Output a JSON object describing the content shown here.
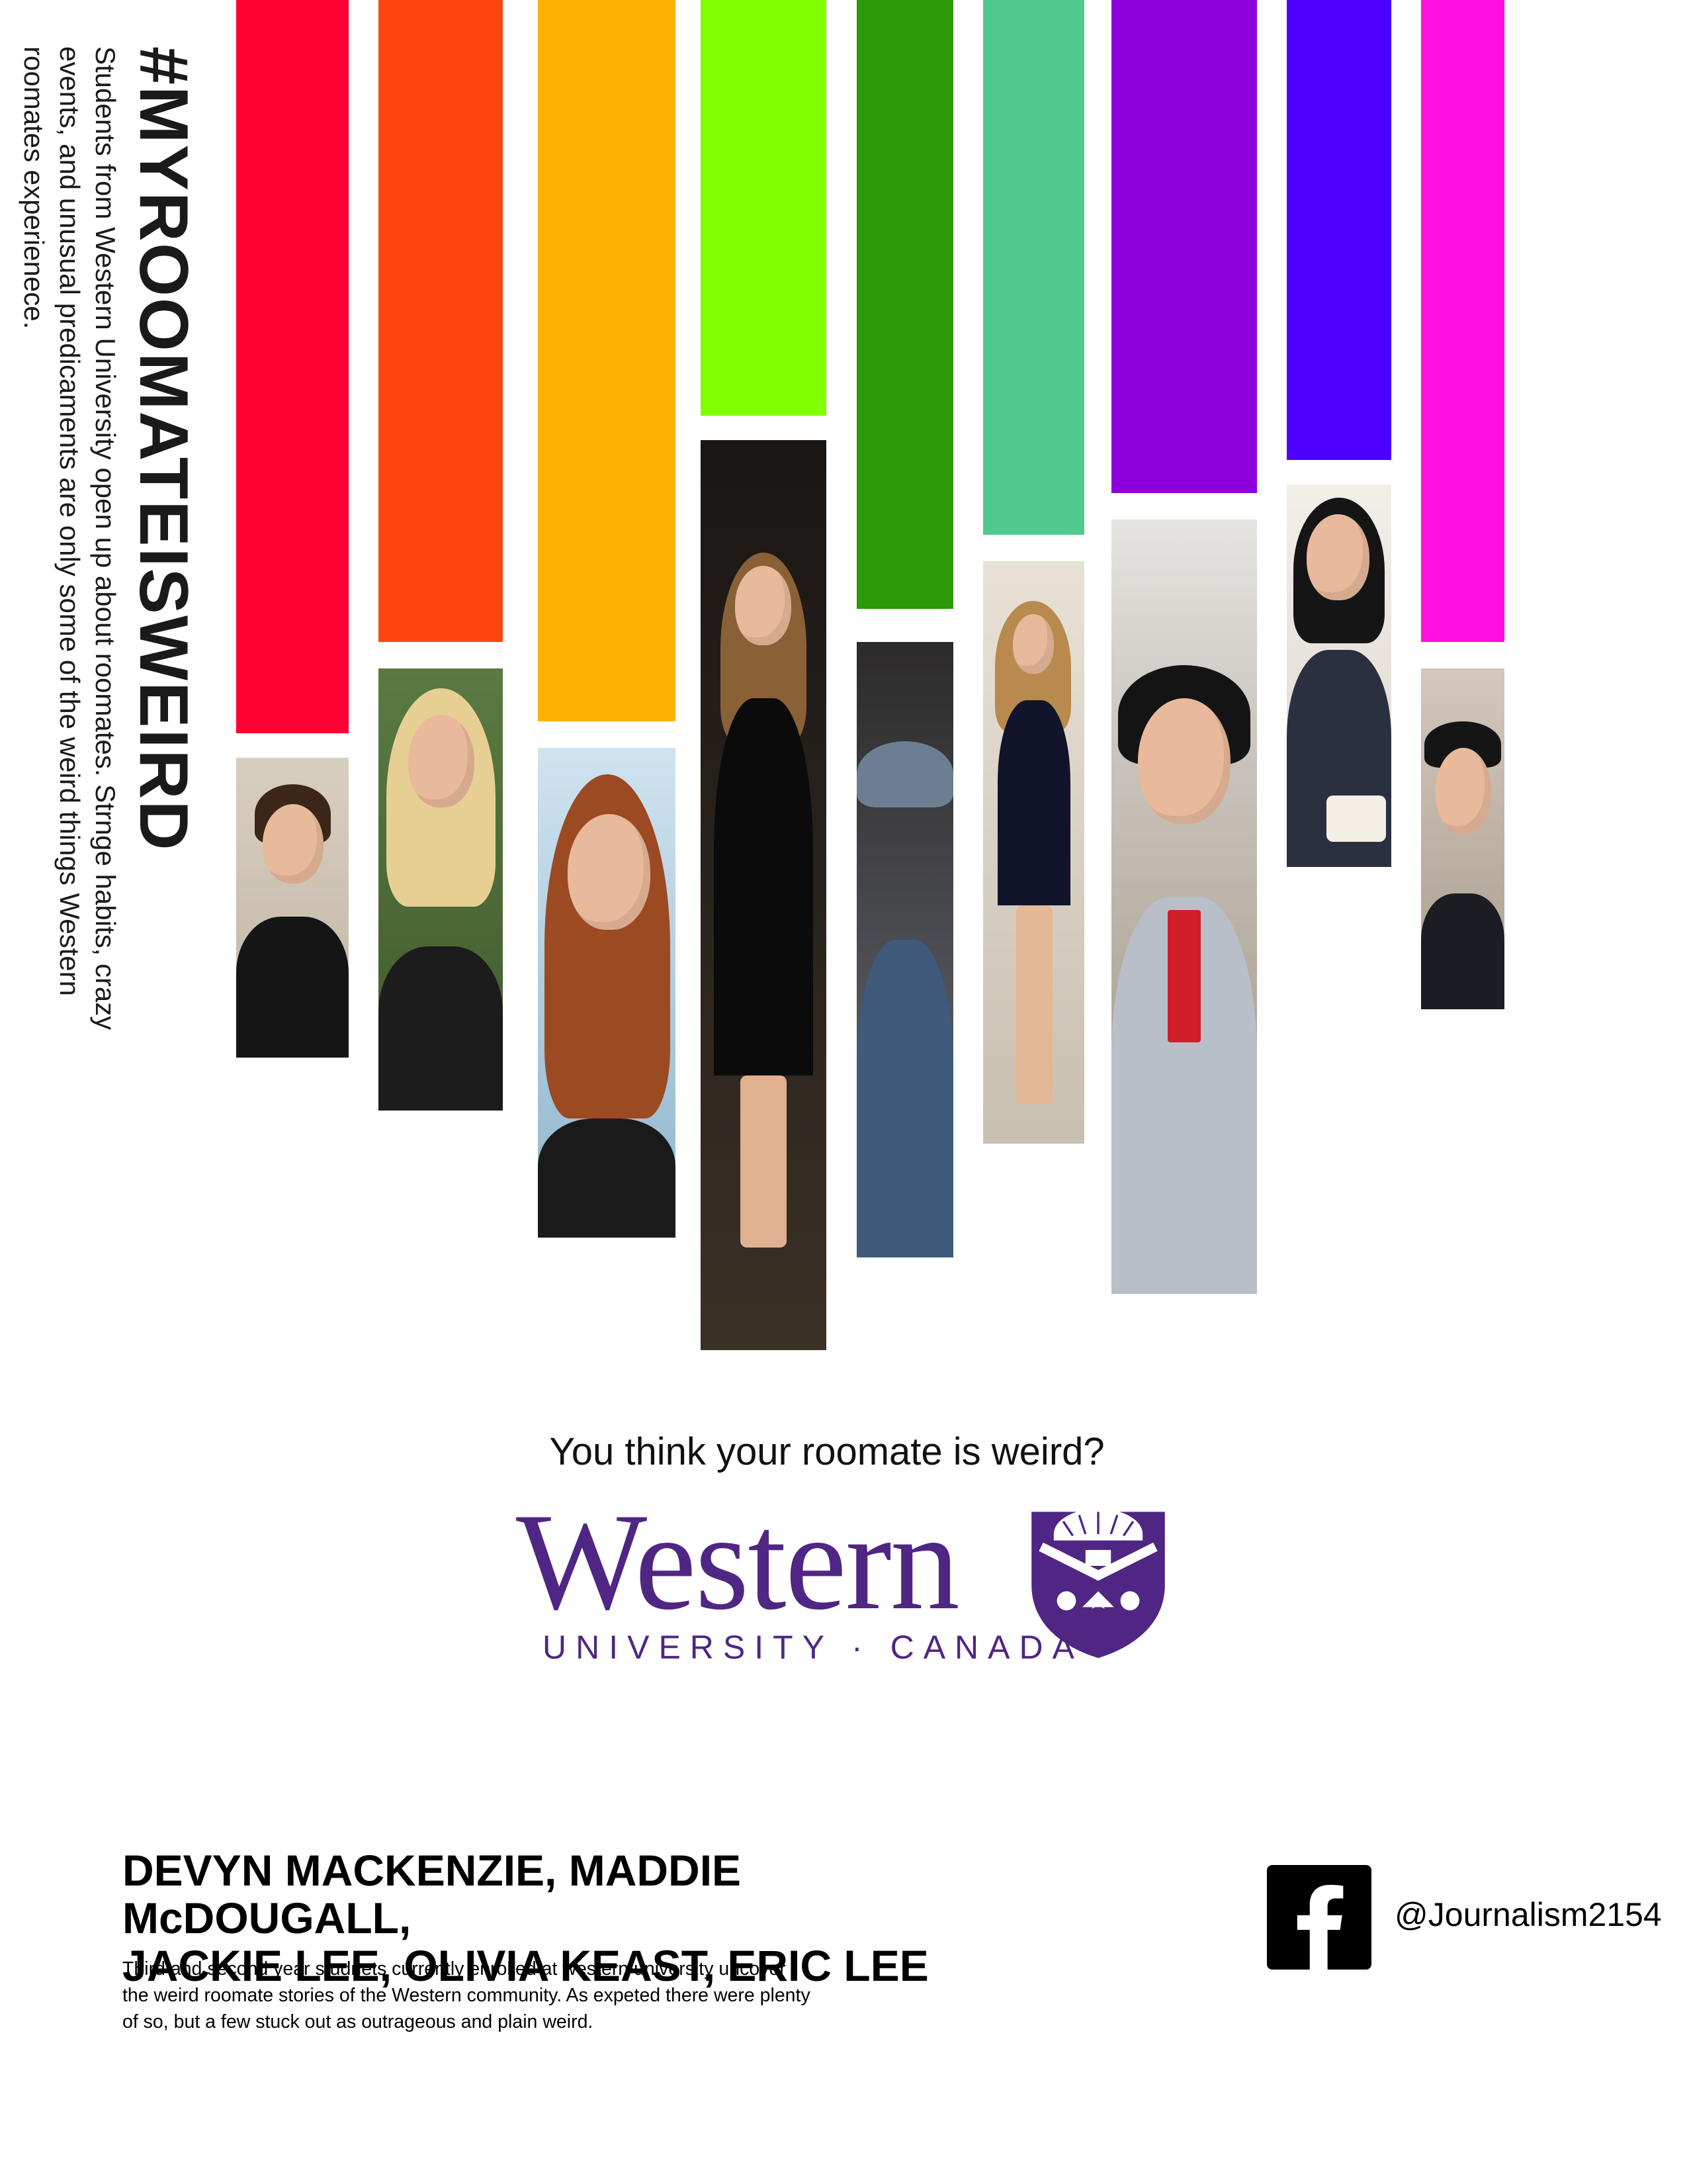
{
  "poster": {
    "hashtag": "#MYROOMATEISWEIRD",
    "tagline": "Students from Western University open up about roomates. Strnge habits, crazy events, and unusual predicaments are only some of the weird things Western roomates experienece.",
    "question": "You think your roomate is weird?",
    "logo": {
      "word": "Western",
      "sub": "UNIVERSITY · CANADA",
      "color": "#4f2683"
    },
    "authors_line1": "DEVYN MACKENZIE, MADDIE McDOUGALL,",
    "authors_line2": "JACKIE LEE, OLIVIA KEAST, ERIC LEE",
    "description": "Third and second year studnets currently enrolled at western university uncover the weird roomate stories of the Western community. As expeted there were plenty of so, but a few stuck out as outrageous and plain weird.",
    "social": {
      "icon": "facebook-icon",
      "handle": "@Journalism2154"
    }
  },
  "bar_colors": [
    "#ff0033",
    "#ff4510",
    "#ffb000",
    "#80ff00",
    "#2a9a06",
    "#4fc98c",
    "#8b00db",
    "#4d00ff",
    "#ff10e0"
  ]
}
